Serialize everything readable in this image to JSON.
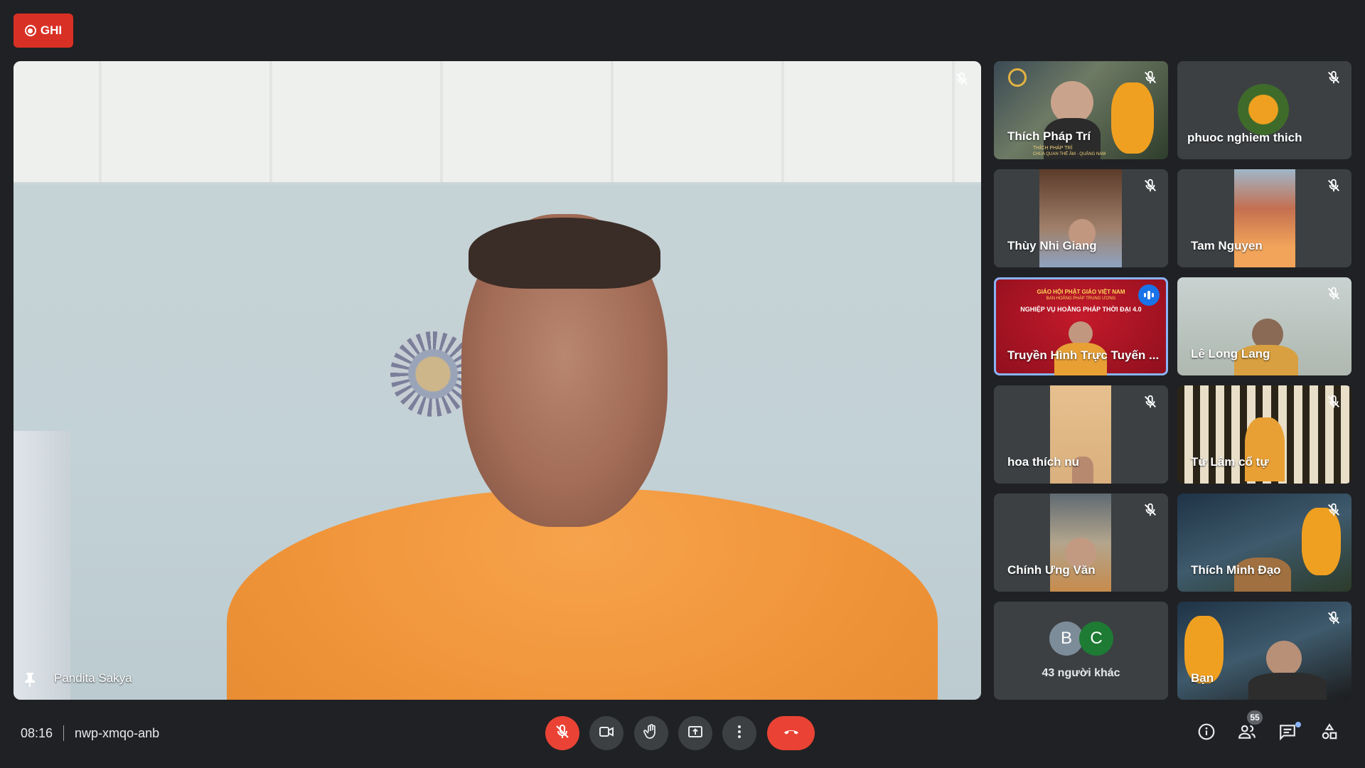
{
  "recording": {
    "label": "GHI"
  },
  "main_participant": {
    "name": "Pandita Sakya"
  },
  "participants": [
    {
      "name": "Thích Pháp Trí",
      "caption_line1": "THÍCH PHÁP TRÍ",
      "caption_line2": "CHÙA QUAN THẾ ÂM - QUẢNG NAM",
      "muted": true
    },
    {
      "name": "phuoc nghiem thich",
      "muted": true
    },
    {
      "name": "Thùy Nhi Giang",
      "muted": true
    },
    {
      "name": "Tam Nguyen",
      "muted": true
    },
    {
      "name": "Truyền Hình Trực Tuyến ...",
      "banner_line1": "GIÁO HỘI PHẬT GIÁO VIỆT NAM",
      "banner_line2": "BAN HOẰNG PHÁP TRUNG ƯƠNG",
      "banner_line3": "NGHIỆP VỤ HOẰNG PHÁP THỜI ĐẠI 4.0",
      "speaking": true
    },
    {
      "name": "Lê Long Lang",
      "muted": true
    },
    {
      "name": "hoa thích nu",
      "muted": true
    },
    {
      "name": "Từ Lâm cổ tự",
      "muted": true
    },
    {
      "name": "Chính Ưng Văn",
      "muted": true
    },
    {
      "name": "Thích Minh Đạo",
      "muted": true
    },
    {
      "name": "Bạn",
      "muted": true
    }
  ],
  "others_tile": {
    "avatars": [
      "B",
      "C"
    ],
    "label": "43 người khác",
    "colors": [
      "#7d8c99",
      "#1e7b34"
    ]
  },
  "meeting": {
    "time": "08:16",
    "code": "nwp-xmqo-anb"
  },
  "controls": [
    "mic-off-icon",
    "camera-icon",
    "raise-hand-icon",
    "present-icon",
    "more-icon",
    "end-call-icon"
  ],
  "right_controls": {
    "people_count": "55",
    "icons": [
      "info-icon",
      "people-icon",
      "chat-icon",
      "activities-icon"
    ]
  },
  "colors": {
    "background": "#202124",
    "tile": "#3c4043",
    "record": "#d93025",
    "end_call": "#ea4335",
    "speaking": "#1a73e8",
    "active_border": "#8ab4f8"
  }
}
